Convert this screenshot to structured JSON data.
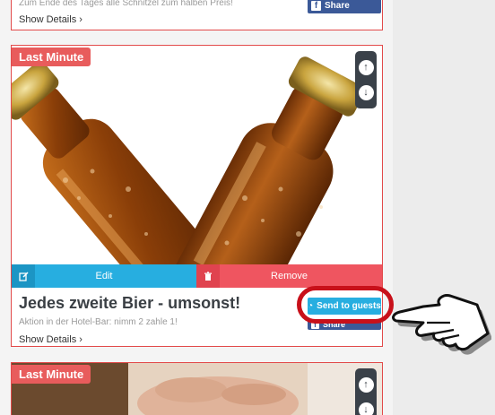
{
  "cards": [
    {
      "description": "Zum Ende des Tages alle Schnitzel zum halben Preis!",
      "details_label": "Show Details",
      "share_label": "Share"
    },
    {
      "badge": "Last Minute",
      "title": "Jedes zweite Bier - umsonst!",
      "description": "Aktion in der Hotel-Bar: nimm 2 zahle 1!",
      "details_label": "Show Details",
      "edit_label": "Edit",
      "remove_label": "Remove",
      "send_label": "Send to guests",
      "share_label": "Share"
    },
    {
      "badge": "Last Minute"
    }
  ],
  "colors": {
    "accent_blue": "#27aee0",
    "remove_red": "#ef5560",
    "facebook_blue": "#3b5998",
    "badge_red": "#e85c5c",
    "highlight_red": "#c8101a"
  }
}
